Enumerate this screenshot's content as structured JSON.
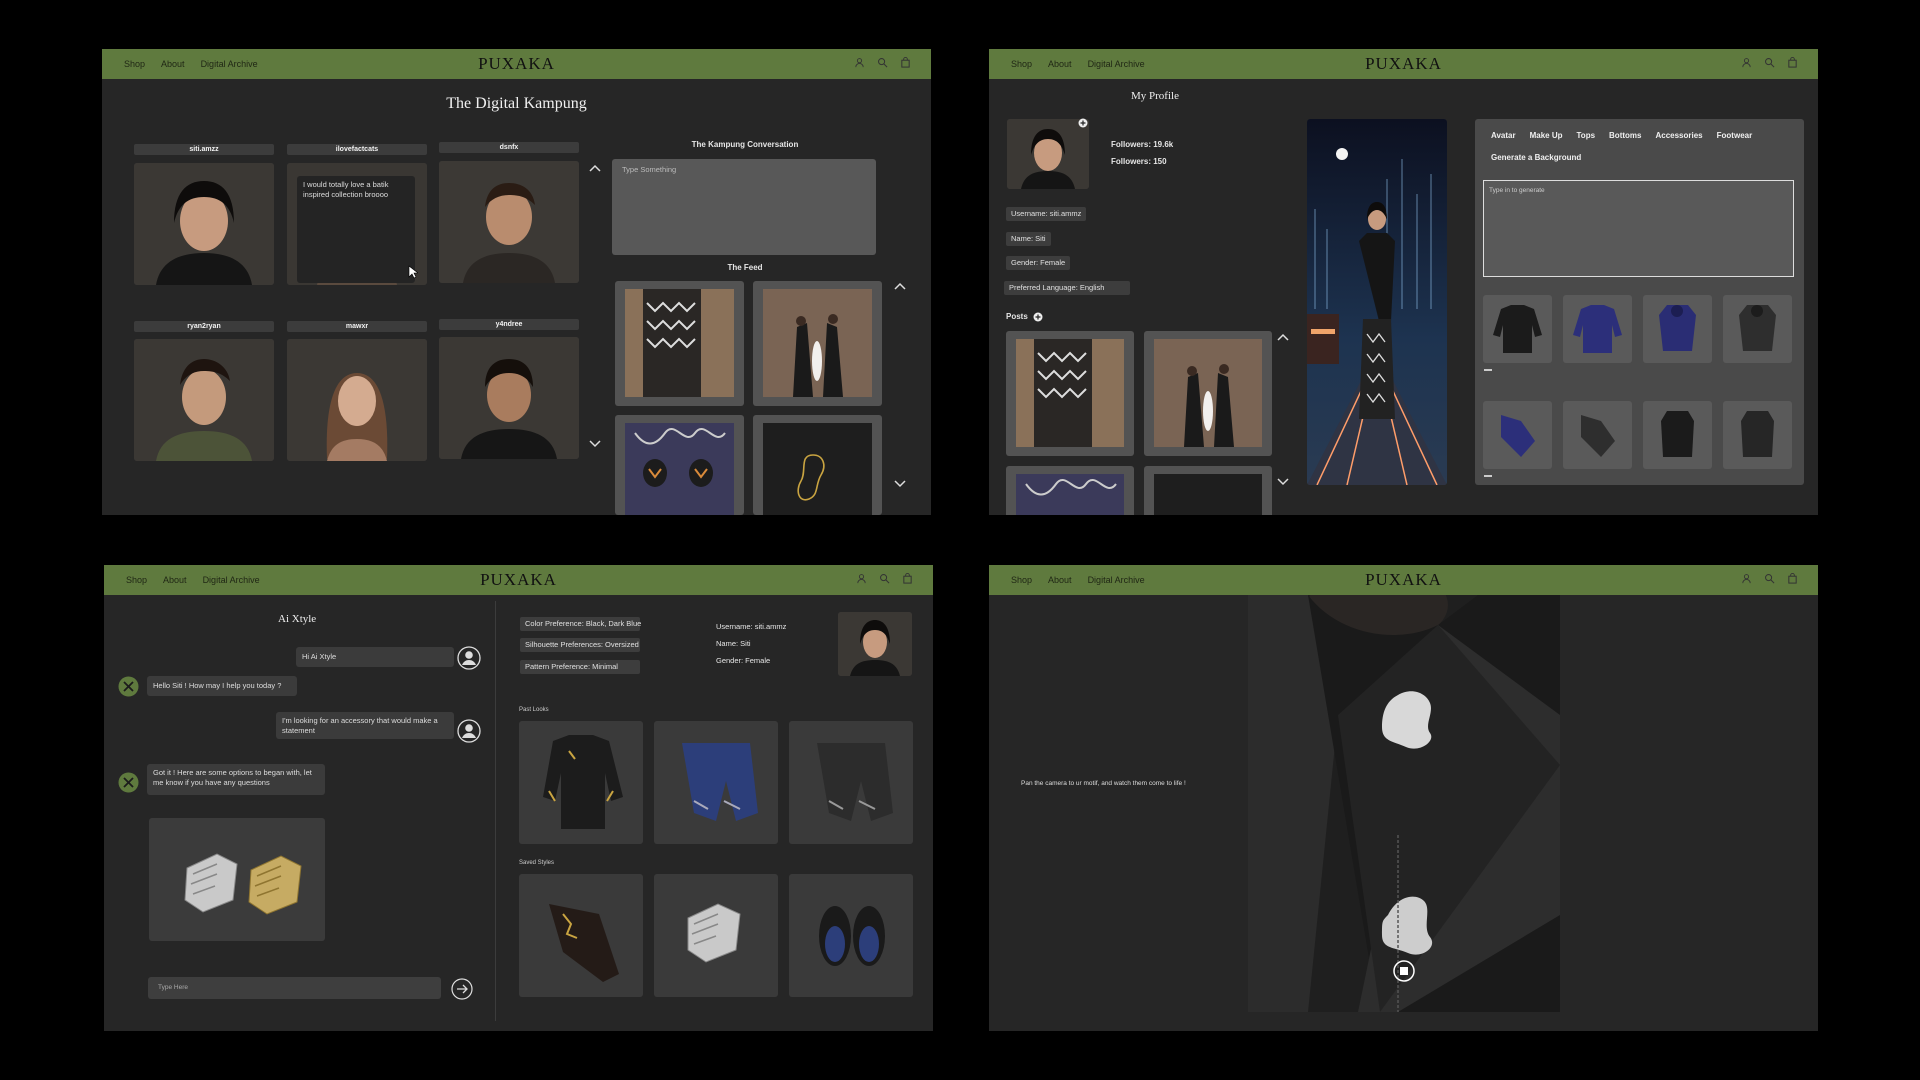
{
  "nav": {
    "links": [
      "Shop",
      "About",
      "Digital Archive"
    ],
    "logo": "PUXAKA"
  },
  "kampung": {
    "title": "The Digital Kampung",
    "users": [
      {
        "name": "siti.amzz"
      },
      {
        "name": "ilovefactcats",
        "message": "I would totally love a batik inspired collection broooo"
      },
      {
        "name": "dsnfx"
      },
      {
        "name": "ryan2ryan"
      },
      {
        "name": "mawxr"
      },
      {
        "name": "y4ndree"
      }
    ],
    "conversation_title": "The Kampung Conversation",
    "conversation_placeholder": "Type Something",
    "feed_title": "The Feed"
  },
  "profile": {
    "title": "My Profile",
    "followers": "Followers: 19.6k",
    "followers2": "Followers: 150",
    "fields": [
      "Username: siti.ammz",
      "Name: Siti",
      "Gender: Female",
      "Preferred Language: English"
    ],
    "posts_label": "Posts",
    "tabs": [
      "Avatar",
      "Make Up",
      "Tops",
      "Bottoms",
      "Accessories",
      "Footwear"
    ],
    "generate_bg": "Generate a Background",
    "generate_placeholder": "Type in to generate"
  },
  "xtyle": {
    "title": "Ai Xtyle",
    "messages": [
      {
        "from": "user",
        "text": "Hi Ai Xtyle"
      },
      {
        "from": "bot",
        "text": "Hello Siti ! How may I help you today ?"
      },
      {
        "from": "user",
        "text": "I'm looking for an accessory that would make a statement"
      },
      {
        "from": "bot",
        "text": "Got it ! Here are some options to began with, let me know if you have any questions"
      }
    ],
    "input_placeholder": "Type Here",
    "prefs": [
      "Color Preference: Black, Dark Blue",
      "Silhouette Preferences: Oversized",
      "Pattern Preference: Minimal"
    ],
    "user_info": [
      "Username: siti.ammz",
      "Name: Siti",
      "Gender: Female"
    ],
    "past_looks": "Past Looks",
    "saved_styles": "Saved Styles"
  },
  "ar": {
    "instruction": "Pan the camera to ur motif, and watch them come to life !"
  }
}
